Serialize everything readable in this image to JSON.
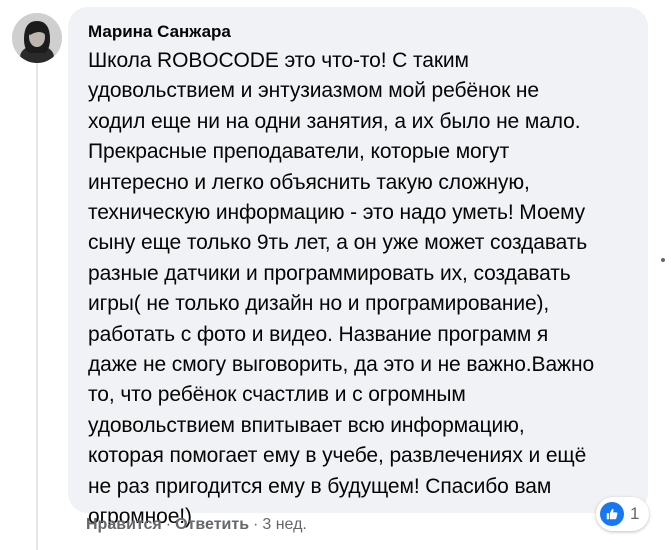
{
  "comment": {
    "author": "Марина Санжара",
    "text": "Школа ROBOCODE это что-то! С таким\nудовольствием и энтузиазмом мой ребёнок не\nходил еще ни на одни занятия, а их было не мало.\nПрекрасные преподаватели, которые могут\nинтересно и легко объяснить такую сложную,\nтехническую информацию - это надо уметь! Моему\nсыну еще только 9ть лет, а он уже может создавать\nразные датчики и программировать их, создавать\nигры( не только дизайн но и програмирование),\nработать с фото и видео. Название программ я\nдаже не смогу выговорить, да это и не важно.Важно\nто, что ребёнок счастлив и с огромным\nудовольствием впитывает всю информацию,\nкоторая помогает ему в учебе, развлечениях и ещё\nне раз пригодится ему в будущем! Спасибо вам\nогромное!)"
  },
  "actions": {
    "like_label": "Нравится",
    "separator": "·",
    "reply_label": "Ответить",
    "time_ago": "3 нед."
  },
  "reactions": {
    "icon": "thumbs-up-icon",
    "count": "1"
  },
  "colors": {
    "bubble_bg": "#f0f2f5",
    "text": "#050505",
    "secondary_text": "#65676b",
    "like_blue": "#1877f2"
  }
}
